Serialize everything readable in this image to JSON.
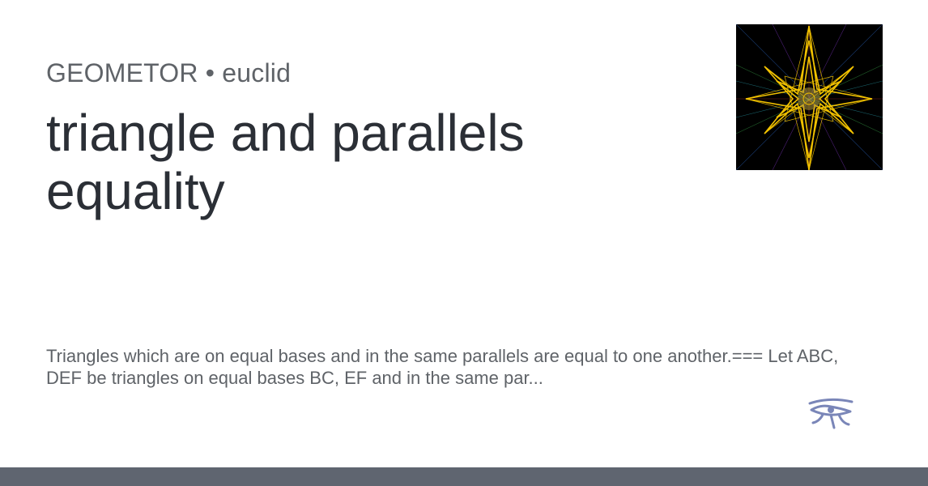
{
  "site": {
    "name": "GEOMETOR • euclid"
  },
  "page": {
    "title": "triangle and parallels equality",
    "description": "Triangles which are on equal bases and in the same parallels are equal to one another.=== Let ABC, DEF be triangles on equal bases BC, EF and in the same par..."
  },
  "thumbnail": {
    "icon": "star-polygon-thumbnail",
    "background": "#000000",
    "star_color": "#f2c200"
  },
  "logo": {
    "icon": "eye-of-horus-icon",
    "color": "#7a86b8"
  },
  "colors": {
    "site_name": "#5f6368",
    "title": "#2b2f36",
    "description": "#5f6368",
    "footer": "#5f6570"
  }
}
